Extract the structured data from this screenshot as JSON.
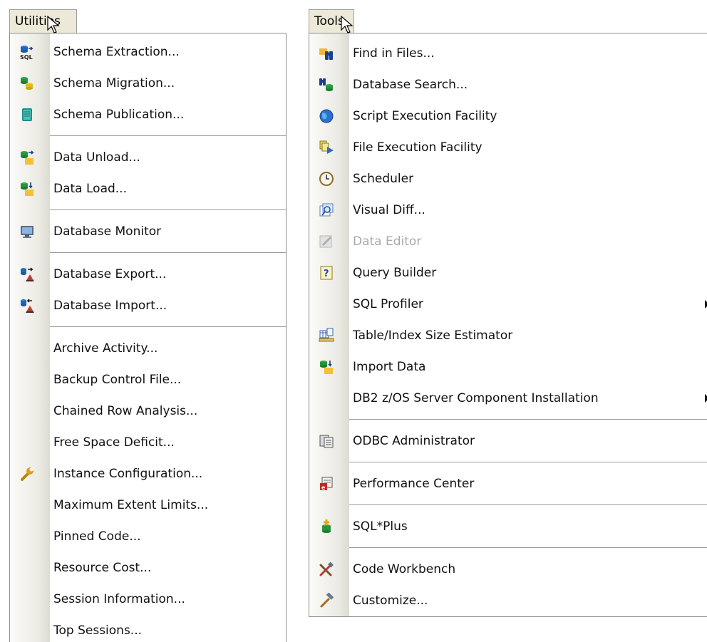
{
  "utilities_menu": {
    "title": "Utilities",
    "items": [
      {
        "label": "Schema Extraction...",
        "icon": "schema-extraction-icon"
      },
      {
        "label": "Schema Migration...",
        "icon": "schema-migration-icon"
      },
      {
        "label": "Schema Publication...",
        "icon": "schema-publication-icon"
      },
      {
        "label": "Data Unload...",
        "icon": "data-unload-icon"
      },
      {
        "label": "Data Load...",
        "icon": "data-load-icon"
      },
      {
        "label": "Database Monitor",
        "icon": "monitor-icon"
      },
      {
        "label": "Database Export...",
        "icon": "database-export-icon"
      },
      {
        "label": "Database Import...",
        "icon": "database-import-icon"
      },
      {
        "label": "Archive Activity..."
      },
      {
        "label": "Backup Control File..."
      },
      {
        "label": "Chained Row Analysis..."
      },
      {
        "label": "Free Space Deficit..."
      },
      {
        "label": "Instance Configuration...",
        "icon": "wrench-icon"
      },
      {
        "label": "Maximum Extent Limits..."
      },
      {
        "label": "Pinned Code..."
      },
      {
        "label": "Resource Cost..."
      },
      {
        "label": "Session Information..."
      },
      {
        "label": "Top Sessions..."
      }
    ]
  },
  "tools_menu": {
    "title": "Tools",
    "items": [
      {
        "label": "Find in Files...",
        "icon": "binoculars-icon"
      },
      {
        "label": "Database Search...",
        "icon": "database-search-icon"
      },
      {
        "label": "Script Execution Facility",
        "icon": "globe-icon"
      },
      {
        "label": "File Execution Facility",
        "icon": "file-execution-icon"
      },
      {
        "label": "Scheduler",
        "icon": "clock-icon"
      },
      {
        "label": "Visual Diff...",
        "icon": "visual-diff-icon"
      },
      {
        "label": "Data Editor",
        "icon": "data-editor-icon",
        "disabled": true
      },
      {
        "label": "Query Builder",
        "icon": "query-builder-icon"
      },
      {
        "label": "SQL Profiler",
        "submenu": true
      },
      {
        "label": "Table/Index Size Estimator",
        "icon": "size-estimator-icon"
      },
      {
        "label": "Import Data",
        "icon": "import-data-icon"
      },
      {
        "label": "DB2 z/OS Server Component Installation",
        "submenu": true
      },
      {
        "label": "ODBC Administrator",
        "icon": "odbc-icon"
      },
      {
        "label": "Performance Center",
        "icon": "performance-center-icon"
      },
      {
        "label": "SQL*Plus",
        "icon": "sqlplus-icon"
      },
      {
        "label": "Code Workbench",
        "icon": "code-workbench-icon"
      },
      {
        "label": "Customize...",
        "icon": "hammer-icon"
      }
    ]
  }
}
